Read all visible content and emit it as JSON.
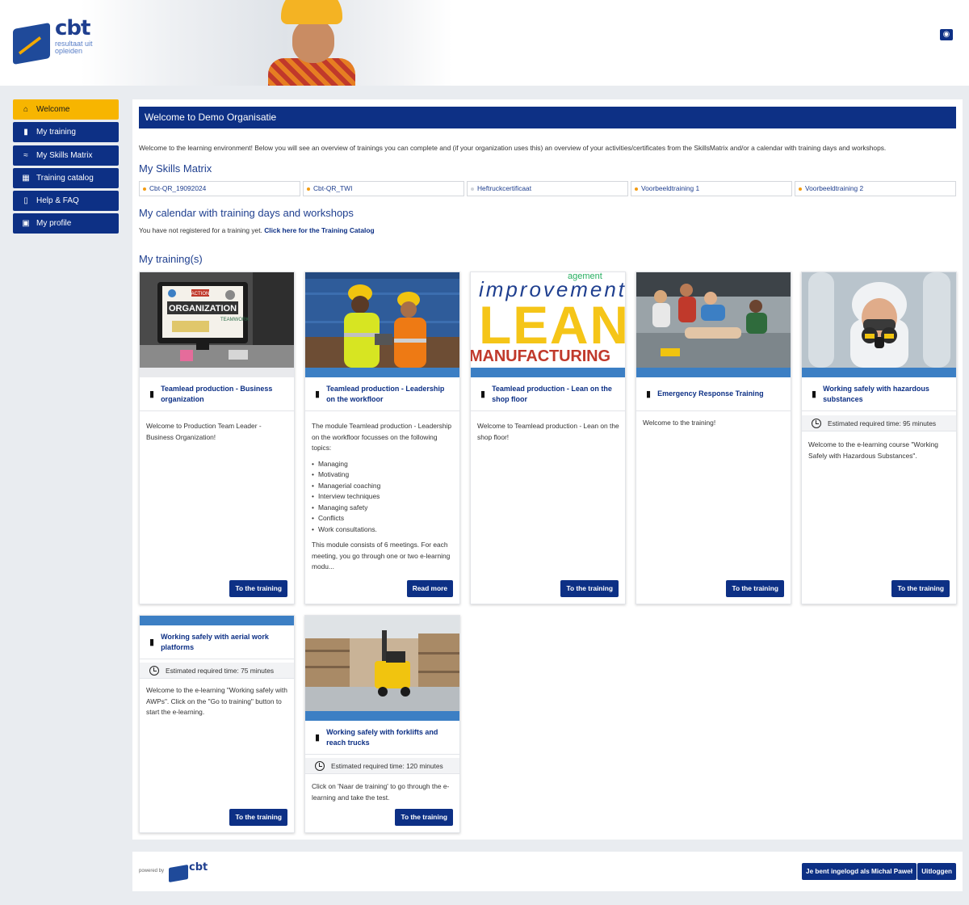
{
  "header": {
    "logo_word": "cbt",
    "logo_tagline": "resultaat uit opleiden",
    "language_icon": "globe-icon"
  },
  "sidebar": {
    "items": [
      {
        "label": "Welcome",
        "icon": "home-icon",
        "active": true
      },
      {
        "label": "My training",
        "icon": "book-icon",
        "active": false
      },
      {
        "label": "My Skills Matrix",
        "icon": "chart-icon",
        "active": false
      },
      {
        "label": "Training catalog",
        "icon": "calendar-icon",
        "active": false
      },
      {
        "label": "Help & FAQ",
        "icon": "document-icon",
        "active": false
      },
      {
        "label": "My profile",
        "icon": "id-card-icon",
        "active": false
      }
    ]
  },
  "main": {
    "banner_title": "Welcome to Demo Organisatie",
    "intro": "Welcome to the learning environment! Below you will see an overview of trainings you can complete and (if your organization uses this) an overview of your activities/certificates from the SkillsMatrix and/or a calendar with training days and workshops.",
    "skills_heading": "My Skills Matrix",
    "skills": [
      {
        "label": "Cbt-QR_19092024",
        "dot_color": "#f39c12"
      },
      {
        "label": "Cbt-QR_TWI",
        "dot_color": "#f39c12"
      },
      {
        "label": "Heftruckcertificaat",
        "dot_color": "#d0d4da"
      },
      {
        "label": "Voorbeeldtraining 1",
        "dot_color": "#f39c12"
      },
      {
        "label": "Voorbeeldtraining 2",
        "dot_color": "#f39c12"
      }
    ],
    "calendar_heading": "My calendar with training days and workshops",
    "calendar_text": "You have not registered for a training yet.",
    "calendar_link": "Click here for the Training Catalog",
    "trainings_heading": "My training(s)"
  },
  "trainings": [
    {
      "title": "Teamlead production - Business organization",
      "description": "Welcome to Production Team Leader - Business Organization!",
      "button": "To the training"
    },
    {
      "title": "Teamlead production - Leadership on the workfloor",
      "description": "The module Teamlead production - Leadership on the workfloor focusses on the following topics:",
      "topics": [
        "Managing",
        "Motivating",
        "Managerial coaching",
        "Interview techniques",
        "Managing safety",
        "Conflicts",
        "Work consultations."
      ],
      "description_after": "This module consists of 6 meetings. For each meeting, you go through one or two e-learning modu...",
      "button": "Read more"
    },
    {
      "title": "Teamlead production - Lean on the shop floor",
      "description": "Welcome to Teamlead production - Lean on the shop floor!",
      "image_words": [
        "improvement",
        "LEAN",
        "MANUFACTURING",
        "agement"
      ],
      "button": "To the training"
    },
    {
      "title": "Emergency Response Training",
      "description": "Welcome to the training!",
      "button": "To the training"
    },
    {
      "title": "Working safely with hazardous substances",
      "time": "Estimated required time: 95 minutes",
      "description": "Welcome to the e-learning course \"Working Safely with Hazardous Substances\".",
      "button": "To the training"
    },
    {
      "title": "Working safely with aerial work platforms",
      "time": "Estimated required time: 75 minutes",
      "description": "Welcome to the e-learning \"Working safely with AWPs\". Click on the \"Go to training\" button to start the e-learning.",
      "button": "To the training"
    },
    {
      "title": "Working safely with forklifts and reach trucks",
      "time": "Estimated required time: 120 minutes",
      "description": "Click on 'Naar de training' to go through the e-learning and take the test.",
      "button": "To the training"
    }
  ],
  "image_labels": {
    "org_slide_title": "ORGANIZATION",
    "org_slide_badge": "ACTION",
    "org_slide_sub": "TEAMWORK"
  },
  "footer": {
    "powered_by": "powered by",
    "powered_logo": "cbt",
    "logged_in": "Je bent ingelogd als Michal Paweł",
    "logout": "Uitloggen"
  }
}
